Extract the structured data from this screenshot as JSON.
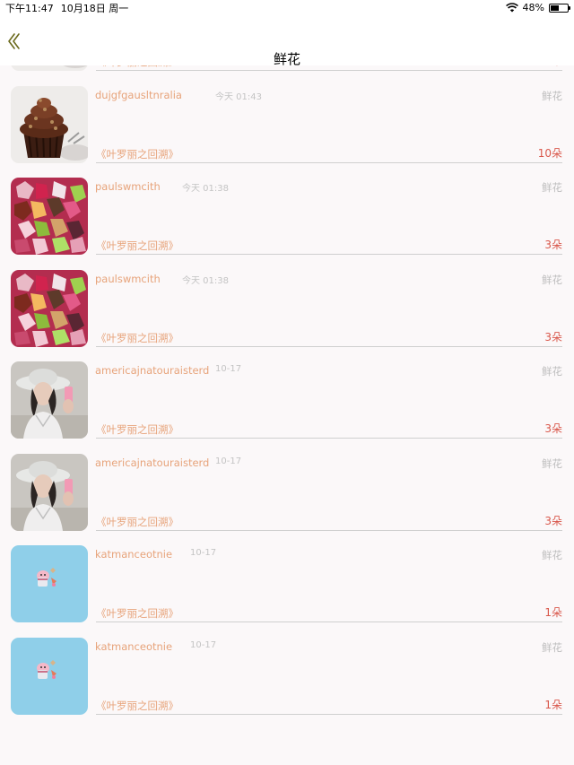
{
  "status_bar": {
    "time": "下午11:47",
    "date": "10月18日 周一",
    "battery": "48%",
    "battery_level": 0.48
  },
  "nav": {
    "title": "鲜花",
    "back_icon": "chevron-left-icon"
  },
  "items": [
    {
      "username": "dujgfgausltnralia",
      "time": "今天 01:43",
      "category": "鲜花",
      "book": "《叶罗丽之回溯》",
      "quantity": "10朵",
      "thumb": "chocolate-cupcake"
    },
    {
      "username": "dujgfgausltnralia",
      "time": "今天 01:43",
      "category": "鲜花",
      "book": "《叶罗丽之回溯》",
      "quantity": "10朵",
      "thumb": "chocolate-cupcake"
    },
    {
      "username": "paulswmcith",
      "time": "今天 01:38",
      "category": "鲜花",
      "book": "《叶罗丽之回溯》",
      "quantity": "3朵",
      "thumb": "origami-paper-flowers"
    },
    {
      "username": "paulswmcith",
      "time": "今天 01:38",
      "category": "鲜花",
      "book": "《叶罗丽之回溯》",
      "quantity": "3朵",
      "thumb": "origami-paper-flowers"
    },
    {
      "username": "americajnatouraisterd",
      "time": "10-17",
      "category": "鲜花",
      "book": "《叶罗丽之回溯》",
      "quantity": "3朵",
      "thumb": "girl-in-hat-selfie"
    },
    {
      "username": "americajnatouraisterd",
      "time": "10-17",
      "category": "鲜花",
      "book": "《叶罗丽之回溯》",
      "quantity": "3朵",
      "thumb": "girl-in-hat-selfie"
    },
    {
      "username": "katmanceotnie",
      "time": "10-17",
      "category": "鲜花",
      "book": "《叶罗丽之回溯》",
      "quantity": "1朵",
      "thumb": "pig-cartoon-blue"
    },
    {
      "username": "katmanceotnie",
      "time": "10-17",
      "category": "鲜花",
      "book": "《叶罗丽之回溯》",
      "quantity": "1朵",
      "thumb": "pig-cartoon-blue"
    }
  ]
}
